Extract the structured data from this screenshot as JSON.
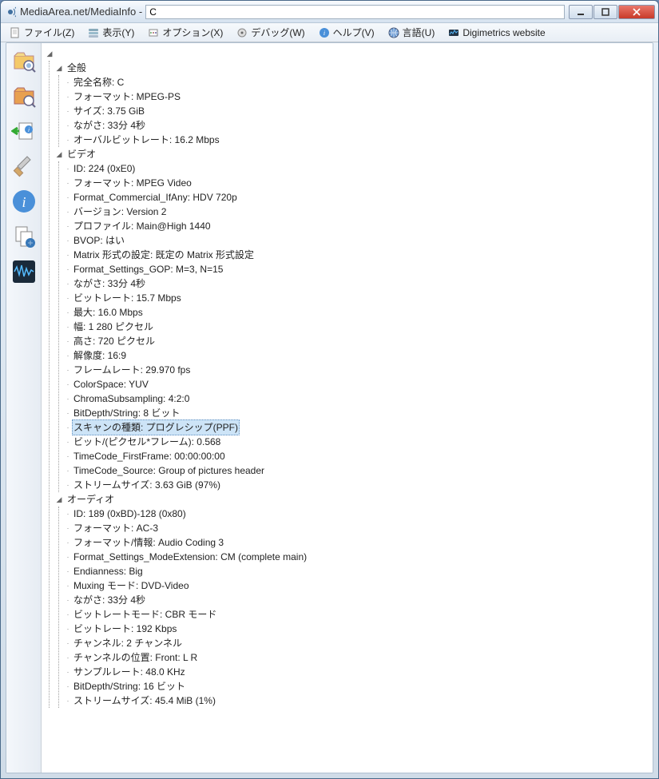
{
  "titlebar": {
    "icon_char": "●))",
    "title": "MediaArea.net/MediaInfo - ",
    "path_char": "C"
  },
  "menus": [
    {
      "id": "file",
      "label": "ファイル(Z)",
      "icon": "📂"
    },
    {
      "id": "view",
      "label": "表示(Y)",
      "icon": ""
    },
    {
      "id": "options",
      "label": "オプション(X)",
      "icon": ""
    },
    {
      "id": "debug",
      "label": "デバッグ(W)",
      "icon": ""
    },
    {
      "id": "help",
      "label": "ヘルプ(V)",
      "icon": "ⓘ"
    },
    {
      "id": "lang",
      "label": "言語(U)",
      "icon": "🌐"
    },
    {
      "id": "digi",
      "label": "Digimetrics website",
      "icon": ""
    }
  ],
  "tree": {
    "sections": [
      {
        "name": "全般",
        "items": [
          "完全名称: C",
          "フォーマット: MPEG-PS",
          "サイズ: 3.75 GiB",
          "ながさ: 33分 4秒",
          "オーバルビットレート: 16.2 Mbps"
        ]
      },
      {
        "name": "ビデオ",
        "items": [
          "ID: 224 (0xE0)",
          "フォーマット: MPEG Video",
          "Format_Commercial_IfAny: HDV 720p",
          "バージョン: Version 2",
          "プロファイル: Main@High 1440",
          "BVOP: はい",
          "Matrix 形式の設定: 既定の Matrix 形式設定",
          "Format_Settings_GOP: M=3, N=15",
          "ながさ: 33分 4秒",
          "ビットレート: 15.7 Mbps",
          "最大: 16.0 Mbps",
          "幅: 1 280 ピクセル",
          "高さ: 720 ピクセル",
          "解像度: 16:9",
          "フレームレート: 29.970 fps",
          "ColorSpace: YUV",
          "ChromaSubsampling: 4:2:0",
          "BitDepth/String: 8 ビット",
          "スキャンの種類: プログレシップ(PPF)",
          "ビット/(ピクセル*フレーム): 0.568",
          "TimeCode_FirstFrame: 00:00:00:00",
          "TimeCode_Source: Group of pictures header",
          "ストリームサイズ: 3.63 GiB (97%)"
        ],
        "selected_index": 18
      },
      {
        "name": "オーディオ",
        "items": [
          "ID: 189 (0xBD)-128 (0x80)",
          "フォーマット: AC-3",
          "フォーマット/情報: Audio Coding 3",
          "Format_Settings_ModeExtension: CM (complete main)",
          "Endianness: Big",
          "Muxing モード: DVD-Video",
          "ながさ: 33分 4秒",
          "ビットレートモード: CBR モード",
          "ビットレート: 192 Kbps",
          "チャンネル: 2 チャンネル",
          "チャンネルの位置: Front: L R",
          "サンプルレート: 48.0 KHz",
          "BitDepth/String: 16 ビット",
          "ストリームサイズ: 45.4 MiB (1%)"
        ]
      }
    ]
  }
}
